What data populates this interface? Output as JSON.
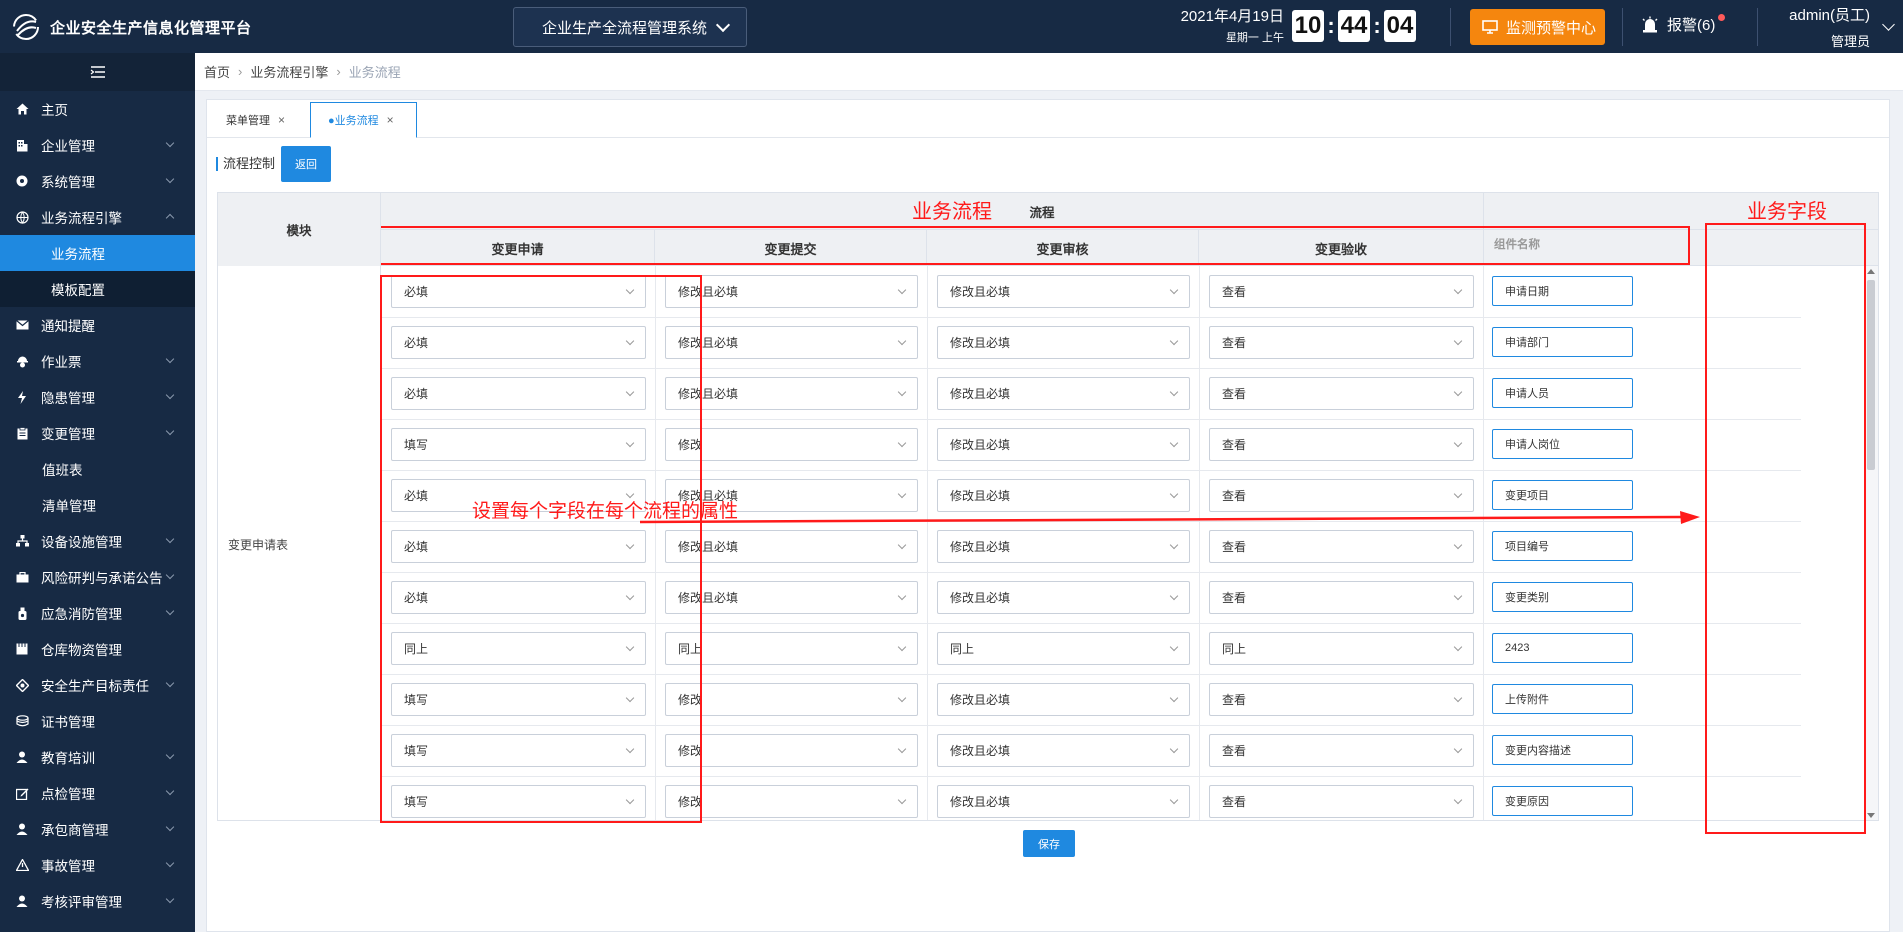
{
  "header": {
    "brand": "企业安全生产信息化管理平台",
    "system": "企业生产全流程管理系统",
    "date": "2021年4月19日",
    "week": "星期一 上午",
    "clock": {
      "h": "10",
      "m": "44",
      "s": "04"
    },
    "monitor_label": "监测预警中心",
    "alarm_label": "报警(6)",
    "user_name": "admin(员工)",
    "user_role": "管理员"
  },
  "sidebar": {
    "items": [
      {
        "label": "主页",
        "icon": "home-icon"
      },
      {
        "label": "企业管理",
        "icon": "building-icon"
      },
      {
        "label": "系统管理",
        "icon": "gear-icon"
      },
      {
        "label": "业务流程引擎",
        "icon": "globe-icon"
      },
      {
        "label": "业务流程",
        "icon": ""
      },
      {
        "label": "模板配置",
        "icon": ""
      },
      {
        "label": "通知提醒",
        "icon": "mail-icon"
      },
      {
        "label": "作业票",
        "icon": "worker-icon"
      },
      {
        "label": "隐患管理",
        "icon": "bolt-icon"
      },
      {
        "label": "变更管理",
        "icon": "clipboard-icon"
      },
      {
        "label": "值班表",
        "icon": ""
      },
      {
        "label": "清单管理",
        "icon": ""
      },
      {
        "label": "设备设施管理",
        "icon": "sitemap-icon"
      },
      {
        "label": "风险研判与承诺公告",
        "icon": "briefcase-icon"
      },
      {
        "label": "应急消防管理",
        "icon": "fire-icon"
      },
      {
        "label": "仓库物资管理",
        "icon": "warehouse-icon"
      },
      {
        "label": "安全生产目标责任",
        "icon": "target-icon"
      },
      {
        "label": "证书管理",
        "icon": "certificate-icon"
      },
      {
        "label": "教育培训",
        "icon": "user-icon"
      },
      {
        "label": "点检管理",
        "icon": "edit-icon"
      },
      {
        "label": "承包商管理",
        "icon": "user-icon"
      },
      {
        "label": "事故管理",
        "icon": "warning-icon"
      },
      {
        "label": "考核评审管理",
        "icon": "user-icon"
      }
    ]
  },
  "breadcrumb": {
    "home": "首页",
    "parent": "业务流程引擎",
    "current": "业务流程"
  },
  "tabs": [
    {
      "label": "菜单管理"
    },
    {
      "label": "●业务流程"
    }
  ],
  "toolbar": {
    "title": "流程控制",
    "back_label": "返回",
    "save_label": "保存"
  },
  "table": {
    "module_header": "模块",
    "flow_header": "流程",
    "steps": [
      "变更申请",
      "变更提交",
      "变更审核",
      "变更验收"
    ],
    "field_header": "组件名称",
    "module_name": "变更申请表",
    "rows": [
      {
        "values": [
          "必填",
          "修改且必填",
          "修改且必填",
          "查看"
        ],
        "field": "申请日期"
      },
      {
        "values": [
          "必填",
          "修改且必填",
          "修改且必填",
          "查看"
        ],
        "field": "申请部门"
      },
      {
        "values": [
          "必填",
          "修改且必填",
          "修改且必填",
          "查看"
        ],
        "field": "申请人员"
      },
      {
        "values": [
          "填写",
          "修改",
          "修改且必填",
          "查看"
        ],
        "field": "申请人岗位"
      },
      {
        "values": [
          "必填",
          "修改且必填",
          "修改且必填",
          "查看"
        ],
        "field": "变更项目"
      },
      {
        "values": [
          "必填",
          "修改且必填",
          "修改且必填",
          "查看"
        ],
        "field": "项目编号"
      },
      {
        "values": [
          "必填",
          "修改且必填",
          "修改且必填",
          "查看"
        ],
        "field": "变更类别"
      },
      {
        "values": [
          "同上",
          "同上",
          "同上",
          "同上"
        ],
        "field": "2423"
      },
      {
        "values": [
          "填写",
          "修改",
          "修改且必填",
          "查看"
        ],
        "field": "上传附件"
      },
      {
        "values": [
          "填写",
          "修改",
          "修改且必填",
          "查看"
        ],
        "field": "变更内容描述"
      },
      {
        "values": [
          "填写",
          "修改",
          "修改且必填",
          "查看"
        ],
        "field": "变更原因"
      }
    ]
  },
  "annotations": {
    "flow_label": "业务流程",
    "field_label": "业务字段",
    "note": "设置每个字段在每个流程的属性"
  }
}
